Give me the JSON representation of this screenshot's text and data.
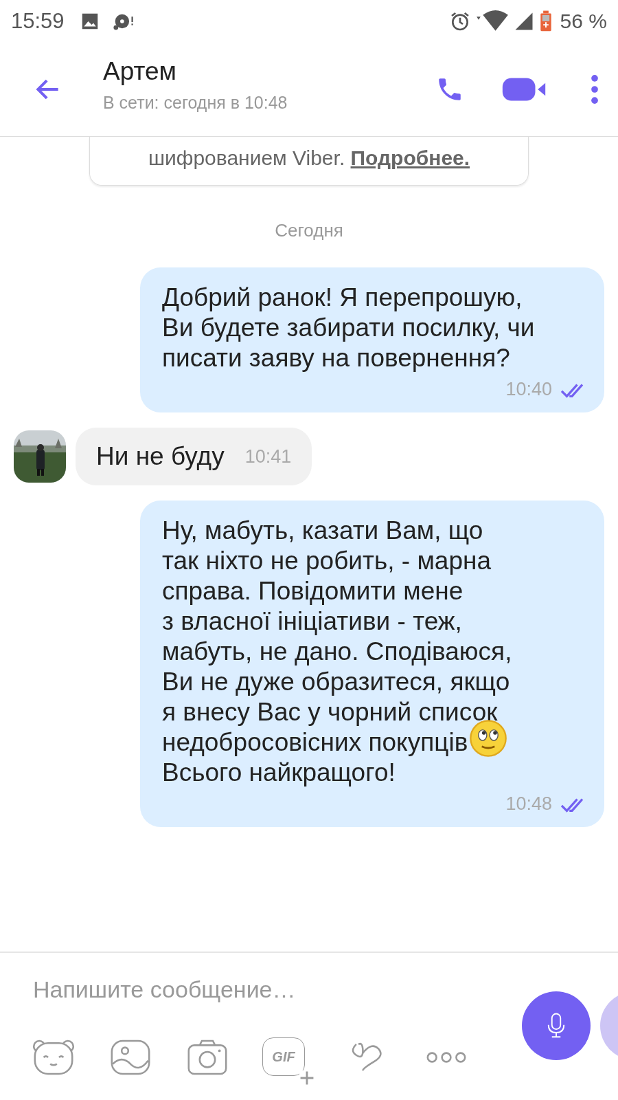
{
  "status_bar": {
    "time": "15:59",
    "battery": "56 %"
  },
  "header": {
    "title": "Артем",
    "subtitle": "В сети: сегодня в 10:48"
  },
  "encryption_notice": {
    "text": "шифрованием Viber.",
    "link": "Подробнее."
  },
  "date_divider": "Сегодня",
  "messages": [
    {
      "kind": "outgoing",
      "lines": [
        {
          "text": "Добрий ранок! Я перепрошую,"
        },
        {
          "text": "Ви будете забирати посилку, чи"
        },
        {
          "text": "писати заяву на повернення?"
        }
      ],
      "time": "10:40",
      "read": true
    },
    {
      "kind": "incoming",
      "lines": [
        {
          "text": "Ни не буду"
        }
      ],
      "time": "10:41"
    },
    {
      "kind": "outgoing",
      "lines": [
        {
          "text": "Ну, мабуть, казати Вам, що"
        },
        {
          "text": "так ніхто не робить, - марна"
        },
        {
          "text": "справа. Повідомити мене"
        },
        {
          "text": "з власної ініціативи - теж,"
        },
        {
          "text": "мабуть, не дано. Сподіваюся,"
        },
        {
          "text": "Ви не дуже образитеся, якщо"
        },
        {
          "text": "я внесу Вас у чорний список"
        },
        {
          "text": "недобросовісних покупців",
          "emoji": true
        },
        {
          "text": "Всього найкращого!"
        }
      ],
      "time": "10:48",
      "read": true
    }
  ],
  "composer": {
    "placeholder": "Напишите сообщение…",
    "gif_label": "GIF"
  }
}
